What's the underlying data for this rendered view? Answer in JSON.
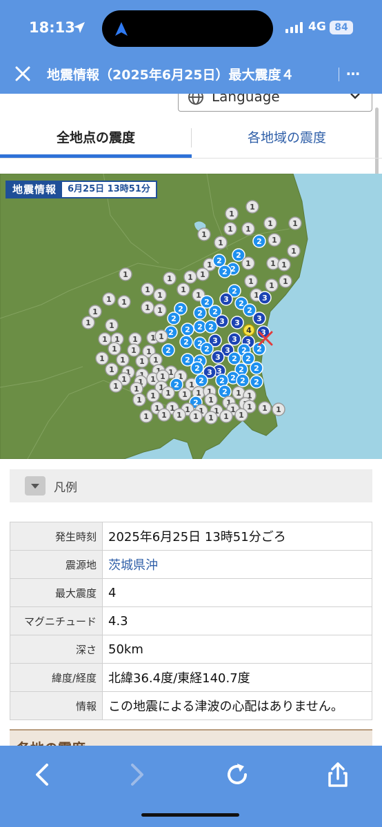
{
  "status_bar": {
    "time": "18:13",
    "network": "4G",
    "battery": "84"
  },
  "top_bar": {
    "title": "地震情報（2025年6月25日）最大震度４",
    "more": "…"
  },
  "language": {
    "label": "Language"
  },
  "tabs": [
    {
      "label": "全地点の震度"
    },
    {
      "label": "各地域の震度"
    }
  ],
  "map": {
    "label_title": "地震情報",
    "label_datetime": "6月25日 13時51分",
    "max_marker": "4",
    "colors": {
      "sea": "#9fd3e4",
      "land": "#6b8e45",
      "level1": "#e6e6e6",
      "level2": "#1e90ef",
      "level3": "#1c44b4",
      "level4": "#f7e348",
      "epicenter": "#e13c3c"
    }
  },
  "legend": {
    "label": "凡例"
  },
  "info_table": [
    {
      "key": "発生時刻",
      "value": "2025年6月25日 13時51分ごろ"
    },
    {
      "key": "震源地",
      "value": "茨城県沖"
    },
    {
      "key": "最大震度",
      "value": "4"
    },
    {
      "key": "マグニチュード",
      "value": "4.3"
    },
    {
      "key": "深さ",
      "value": "50km"
    },
    {
      "key": "緯度/経度",
      "value": "北緯36.4度/東経140.7度"
    },
    {
      "key": "情報",
      "value": "この地震による津波の心配はありません。"
    }
  ],
  "region_header": {
    "label": "各地の震度"
  }
}
